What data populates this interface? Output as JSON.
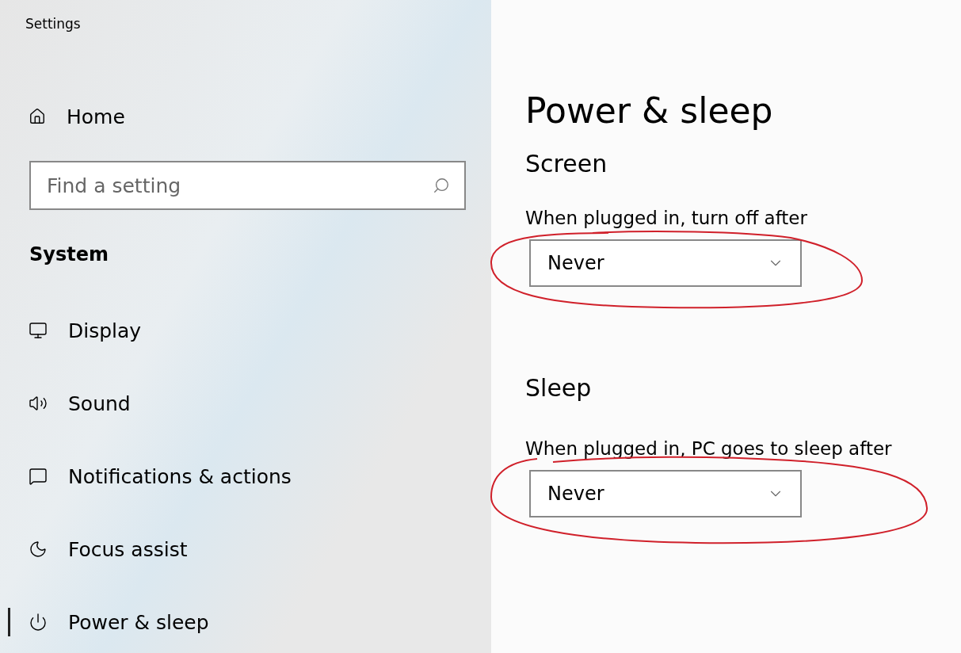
{
  "window": {
    "title": "Settings"
  },
  "sidebar": {
    "home": "Home",
    "search": {
      "placeholder": "Find a setting"
    },
    "section": "System",
    "items": [
      {
        "label": "Display",
        "selected": false
      },
      {
        "label": "Sound",
        "selected": false
      },
      {
        "label": "Notifications & actions",
        "selected": false
      },
      {
        "label": "Focus assist",
        "selected": false
      },
      {
        "label": "Power & sleep",
        "selected": true
      }
    ]
  },
  "page": {
    "title": "Power & sleep",
    "groups": [
      {
        "heading": "Screen",
        "label": "When plugged in, turn off after",
        "value": "Never",
        "circled": true
      },
      {
        "heading": "Sleep",
        "label": "When plugged in, PC goes to sleep after",
        "value": "Never",
        "circled": true
      }
    ]
  }
}
